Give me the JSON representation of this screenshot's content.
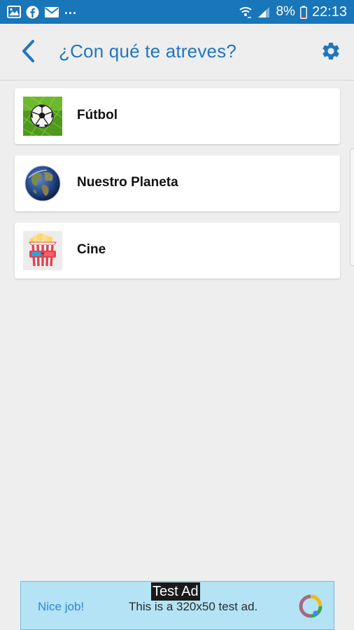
{
  "status_bar": {
    "notification_icons": [
      "gallery-icon",
      "facebook-icon",
      "mail-icon"
    ],
    "overflow": "...",
    "battery_percent": "8%",
    "time": "22:13"
  },
  "app_bar": {
    "title": "¿Con qué te atreves?",
    "accent_color": "#1f76bd"
  },
  "categories": [
    {
      "label": "Fútbol",
      "icon": "soccer-ball-icon"
    },
    {
      "label": "Nuestro Planeta",
      "icon": "earth-globe-icon"
    },
    {
      "label": "Cine",
      "icon": "popcorn-3d-glasses-icon"
    }
  ],
  "ad": {
    "tag": "Test Ad",
    "headline": "Nice job!",
    "description": "This is a 320x50 test ad."
  }
}
